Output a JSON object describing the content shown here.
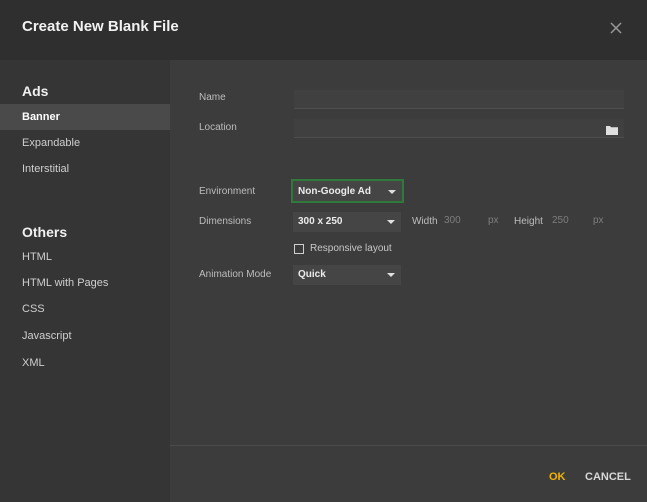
{
  "dialog": {
    "title": "Create New Blank File"
  },
  "sidebar": {
    "ads_title": "Ads",
    "ads_items": [
      "Banner",
      "Expandable",
      "Interstitial"
    ],
    "others_title": "Others",
    "others_items": [
      "HTML",
      "HTML with Pages",
      "CSS",
      "Javascript",
      "XML"
    ],
    "selected": "Banner"
  },
  "form": {
    "name_label": "Name",
    "name_value": "",
    "location_label": "Location",
    "location_value": "",
    "environment_label": "Environment",
    "environment_value": "Non-Google Ad",
    "dimensions_label": "Dimensions",
    "dimensions_value": "300 x 250",
    "width_label": "Width",
    "width_value": "300",
    "width_unit": "px",
    "height_label": "Height",
    "height_value": "250",
    "height_unit": "px",
    "responsive_label": "Responsive layout",
    "responsive_checked": false,
    "animation_label": "Animation Mode",
    "animation_value": "Quick"
  },
  "footer": {
    "ok_label": "OK",
    "cancel_label": "CANCEL"
  },
  "colors": {
    "accent": "#f2b200",
    "highlight_border": "#2f7a3a",
    "background": "#3c3c3c"
  },
  "icons": {
    "close": "close-icon",
    "folder": "folder-icon",
    "dropdown": "chevron-down-icon"
  }
}
